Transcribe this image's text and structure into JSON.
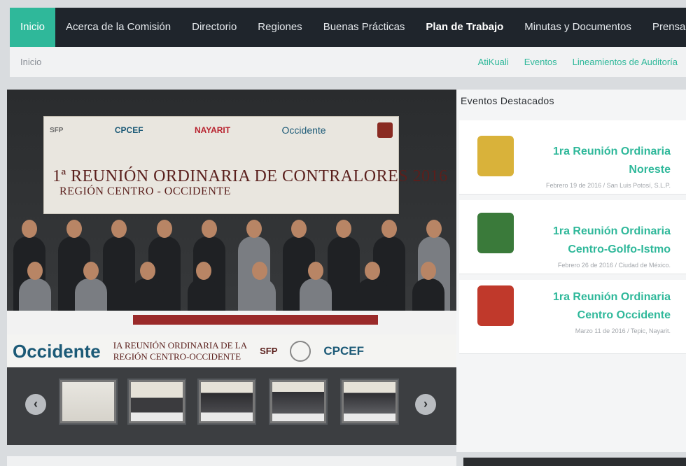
{
  "nav": {
    "items": [
      {
        "label": "Inicio"
      },
      {
        "label": "Acerca de la Comisión"
      },
      {
        "label": "Directorio"
      },
      {
        "label": "Regiones"
      },
      {
        "label": "Buenas Prácticas"
      },
      {
        "label": "Plan de Trabajo"
      },
      {
        "label": "Minutas y Documentos"
      },
      {
        "label": "Prensa"
      }
    ],
    "accent_color": "#2fb89a",
    "bg_color": "#1f252c"
  },
  "breadcrumb": {
    "current": "Inicio",
    "links": [
      "AtiKuali",
      "Eventos",
      "Lineamientos de Auditoría"
    ]
  },
  "slider": {
    "banner": {
      "logo_sfp": "SFP",
      "logo_cpcef": "CPCEF",
      "logo_nayarit": "NAYARIT",
      "logo_occidente": "Occidente",
      "title": "1ª REUNIÓN ORDINARIA DE CONTRALORES 2016",
      "subtitle": "REGIÓN CENTRO - OCCIDENTE"
    },
    "plaque": {
      "occidente": "Occidente",
      "text_line1": "IA REUNIÓN ORDINARIA DE LA",
      "text_line2": "REGIÓN CENTRO-OCCIDENTE",
      "sfp": "SFP",
      "cpcef": "CPCEF"
    },
    "prev_icon": "‹",
    "next_icon": "›",
    "thumbnail_count": 5
  },
  "events": {
    "heading": "Eventos  Destacados",
    "items": [
      {
        "title_line1": "1ra Reunión Ordinaria",
        "title_line2": "Noreste",
        "date": "Febrero 19 de 2016 / San Luis Potosí, S.L.P.",
        "shield_color": "#d9b23a"
      },
      {
        "title_line1": "1ra Reunión Ordinaria",
        "title_line2": "Centro-Golfo-Istmo",
        "date": "Febrero 26 de 2016 / Ciudad de México.",
        "shield_color": "#3a7a3a"
      },
      {
        "title_line1": "1ra Reunión Ordinaria",
        "title_line2": "Centro Occidente",
        "date": "Marzo 11 de 2016 / Tepic, Nayarit.",
        "shield_color": "#c0392b"
      }
    ]
  }
}
